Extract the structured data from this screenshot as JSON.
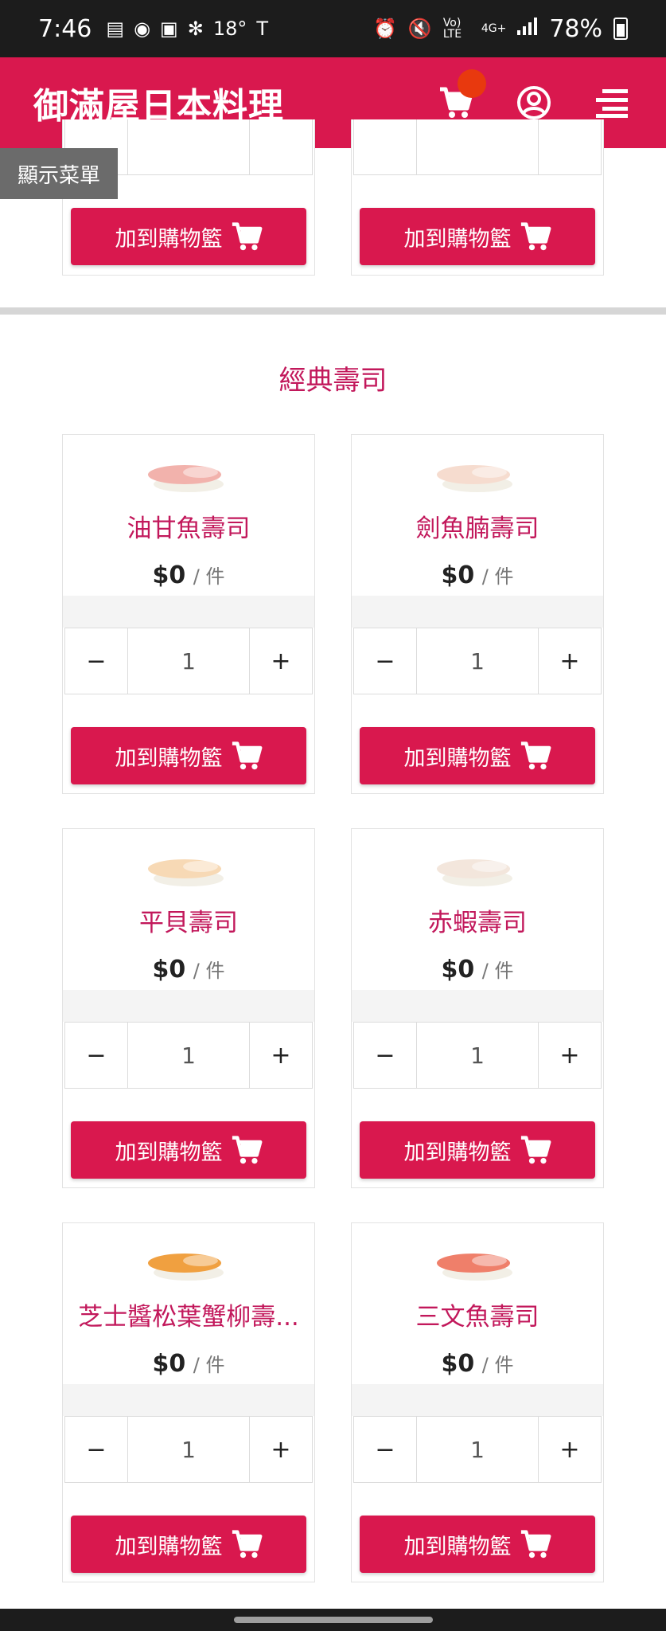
{
  "status_bar": {
    "time": "7:46",
    "temperature": "18°",
    "battery": "78%",
    "icons_left": [
      "message-icon",
      "app-icon",
      "weather-app-icon",
      "fan-icon",
      "tesla-icon"
    ],
    "icons_right": [
      "alarm-icon",
      "mute-icon",
      "volte-icon",
      "4g-icon",
      "signal-icon",
      "battery-icon"
    ],
    "network_label": "4G+",
    "volte_label": "Vo) LTE"
  },
  "header": {
    "brand": "御滿屋日本料理",
    "color": "#d9184e",
    "icons": [
      "cart-icon",
      "user-icon",
      "menu-icon"
    ]
  },
  "show_menu_label": "顯示菜單",
  "add_to_cart_label": "加到購物籃",
  "section": {
    "title": "經典壽司"
  },
  "top_partial_cards": [
    {
      "add_label": "加到購物籃"
    },
    {
      "add_label": "加到購物籃"
    }
  ],
  "products": [
    {
      "name": "油甘魚壽司",
      "price": "$0",
      "unit": "/ 件",
      "qty": "1",
      "minus": "−",
      "plus": "+",
      "add_label": "加到購物籃"
    },
    {
      "name": "劍魚腩壽司",
      "price": "$0",
      "unit": "/ 件",
      "qty": "1",
      "minus": "−",
      "plus": "+",
      "add_label": "加到購物籃"
    },
    {
      "name": "平貝壽司",
      "price": "$0",
      "unit": "/ 件",
      "qty": "1",
      "minus": "−",
      "plus": "+",
      "add_label": "加到購物籃"
    },
    {
      "name": "赤蝦壽司",
      "price": "$0",
      "unit": "/ 件",
      "qty": "1",
      "minus": "−",
      "plus": "+",
      "add_label": "加到購物籃"
    },
    {
      "name": "芝士醬松葉蟹柳壽...",
      "price": "$0",
      "unit": "/ 件",
      "qty": "1",
      "minus": "−",
      "plus": "+",
      "add_label": "加到購物籃"
    },
    {
      "name": "三文魚壽司",
      "price": "$0",
      "unit": "/ 件",
      "qty": "1",
      "minus": "−",
      "plus": "+",
      "add_label": "加到購物籃"
    }
  ]
}
